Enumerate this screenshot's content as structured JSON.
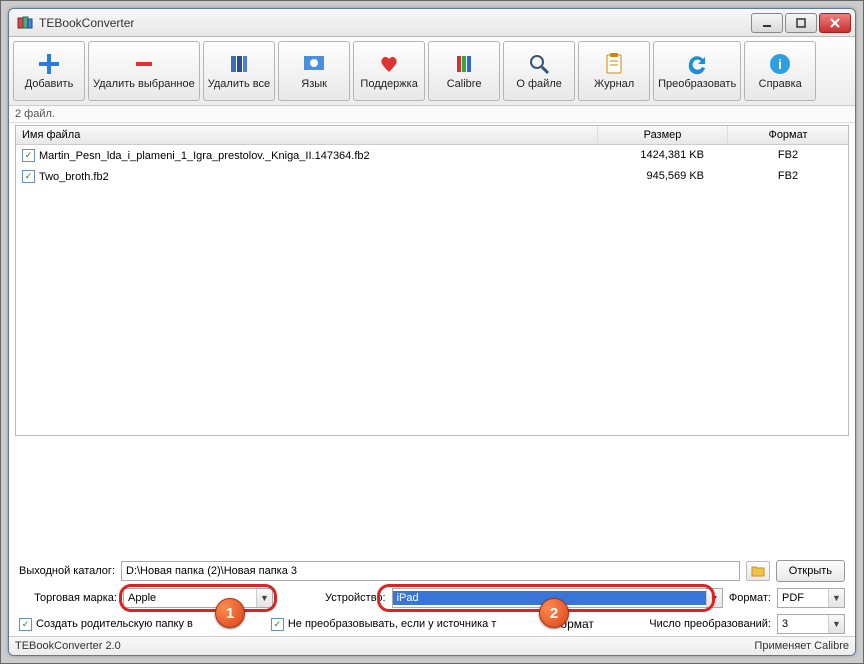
{
  "title": "TEBookConverter",
  "toolbar": {
    "add": "Добавить",
    "del_selected": "Удалить выбранное",
    "del_all": "Удалить все",
    "lang": "Язык",
    "support": "Поддержка",
    "calibre": "Calibre",
    "about": "О файле",
    "journal": "Журнал",
    "convert": "Преобразовать",
    "help": "Справка"
  },
  "status_files": "2 файл.",
  "columns": {
    "name": "Имя файла",
    "size": "Размер",
    "format": "Формат"
  },
  "rows": [
    {
      "name": "Martin_Pesn_lda_i_plameni_1_Igra_prestolov._Kniga_II.147364.fb2",
      "size": "1424,381 KB",
      "format": "FB2"
    },
    {
      "name": "Two_broth.fb2",
      "size": "945,569 KB",
      "format": "FB2"
    }
  ],
  "labels": {
    "out_dir": "Выходной каталог:",
    "brand": "Торговая марка:",
    "device": "Устройство:",
    "format": "Формат:",
    "open": "Открыть",
    "create_parent": "Создать родительскую папку в",
    "no_convert": "Не преобразовывать, если у источника т",
    "no_convert_tail": "ормат",
    "conv_count": "Число преобразований:"
  },
  "values": {
    "out_dir": "D:\\Новая папка (2)\\Новая папка 3",
    "brand": "Apple",
    "device": "iPad",
    "format": "PDF",
    "conv_count": "3"
  },
  "footer": {
    "left": "TEBookConverter 2.0",
    "right": "Применяет Calibre"
  },
  "annotations": {
    "badge1": "1",
    "badge2": "2"
  }
}
